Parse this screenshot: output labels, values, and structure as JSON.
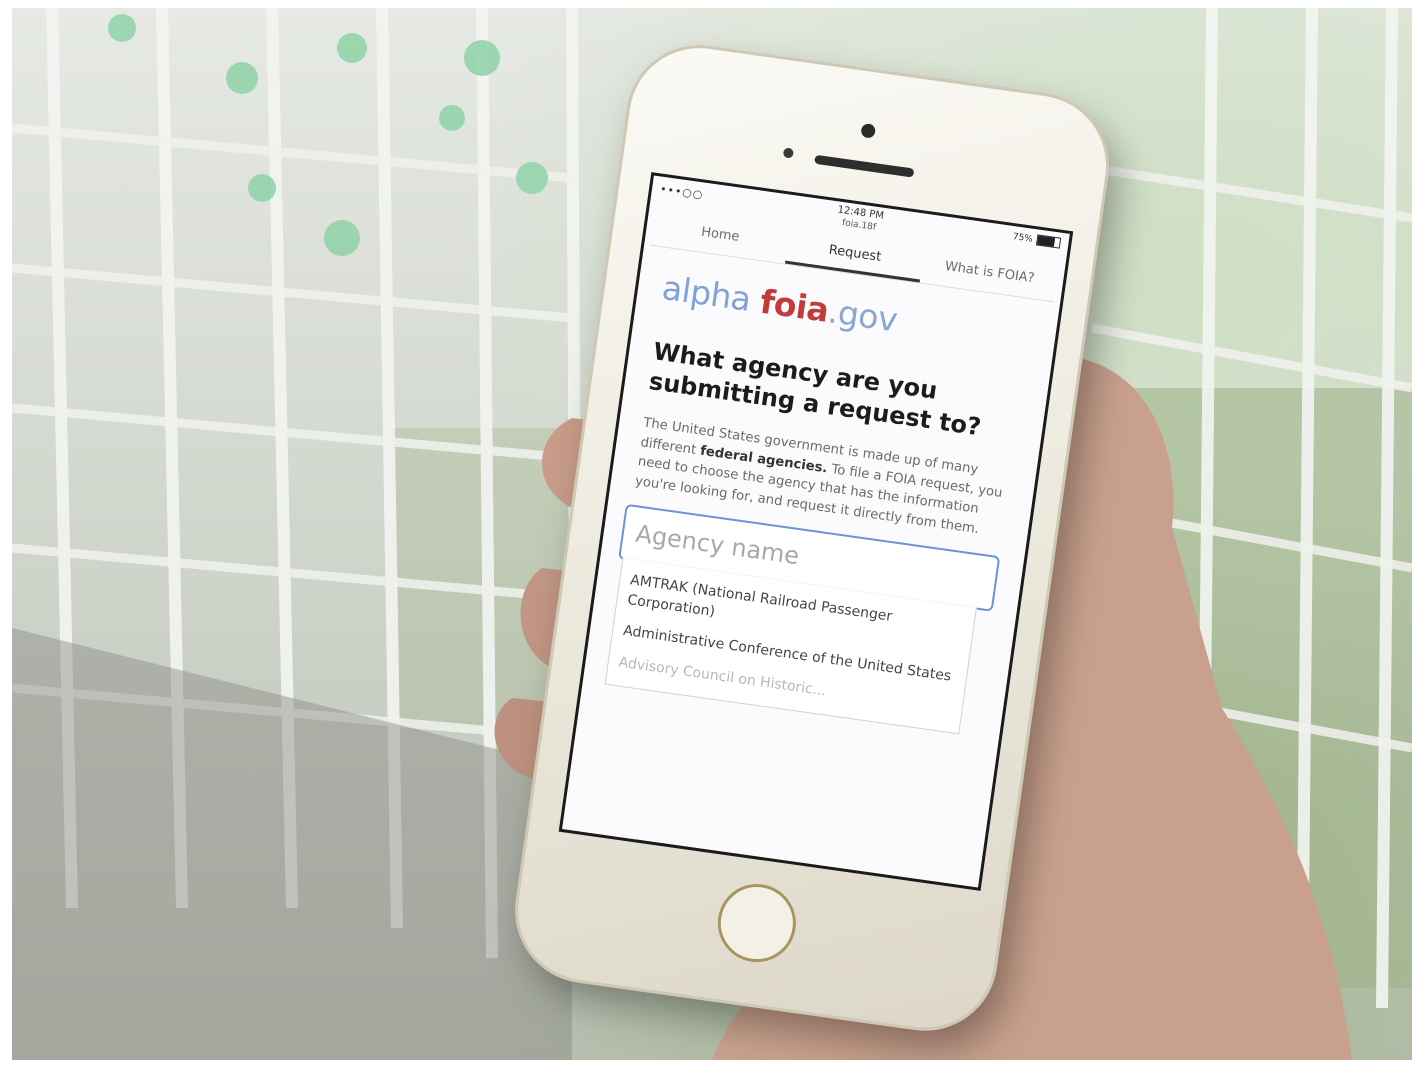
{
  "status_bar": {
    "time": "12:48 PM",
    "url": "foia.18f",
    "battery_percent": "75%",
    "battery_level": 0.75
  },
  "nav": {
    "tabs": [
      {
        "label": "Home",
        "active": false
      },
      {
        "label": "Request",
        "active": true
      },
      {
        "label": "What is FOIA?",
        "active": false
      }
    ]
  },
  "logo": {
    "part1": "alpha",
    "part2": "foia",
    "part3": ".gov"
  },
  "heading": "What agency are you submitting a request to?",
  "intro": {
    "text1": "The United States government is made up of many different ",
    "bold": "federal agencies.",
    "text2": " To file a FOIA request, you need to choose the agency that has the information you're looking for, and request it directly from them."
  },
  "search": {
    "placeholder": "Agency name"
  },
  "suggestions": [
    "AMTRAK (National Railroad Passenger Corporation)",
    "Administrative Conference of the United States",
    "Advisory Council on Historic..."
  ]
}
